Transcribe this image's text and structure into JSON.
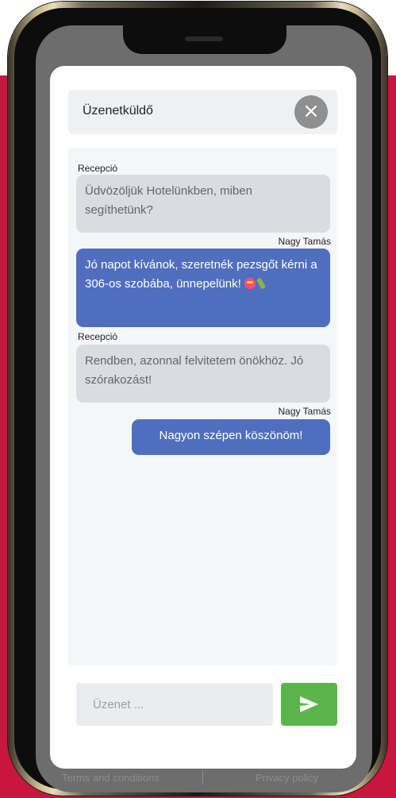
{
  "app": {
    "title": "Üzenetküldő",
    "close_symbol": "×"
  },
  "messages": [
    {
      "sender": "Recepció",
      "side": "received",
      "text": "Üdvözöljük Hotelünkben, miben segíthetünk?"
    },
    {
      "sender": "Nagy Tamás",
      "side": "sent",
      "text": "Jó napot kívánok, szeretnék pezsgőt kérni a 306-os szobába, ünnepelünk!",
      "emoji": [
        "star-struck-emoji",
        "bottle-emoji"
      ]
    },
    {
      "sender": "Recepció",
      "side": "received",
      "text": "Rendben, azonnal felvitetem önökhöz. Jó szórakozást!"
    },
    {
      "sender": "Nagy Tamás",
      "side": "sent",
      "text": "Nagyon szépen köszönöm!"
    }
  ],
  "composer": {
    "placeholder": "Üzenet ...",
    "value": ""
  },
  "footer": {
    "terms": "Terms and conditions",
    "privacy": "Privacy policy"
  },
  "colors": {
    "accent_background": "#c8163f",
    "sent_bubble": "#4f6fbe",
    "received_bubble": "#d9dce1",
    "send_button": "#5bb54a"
  }
}
